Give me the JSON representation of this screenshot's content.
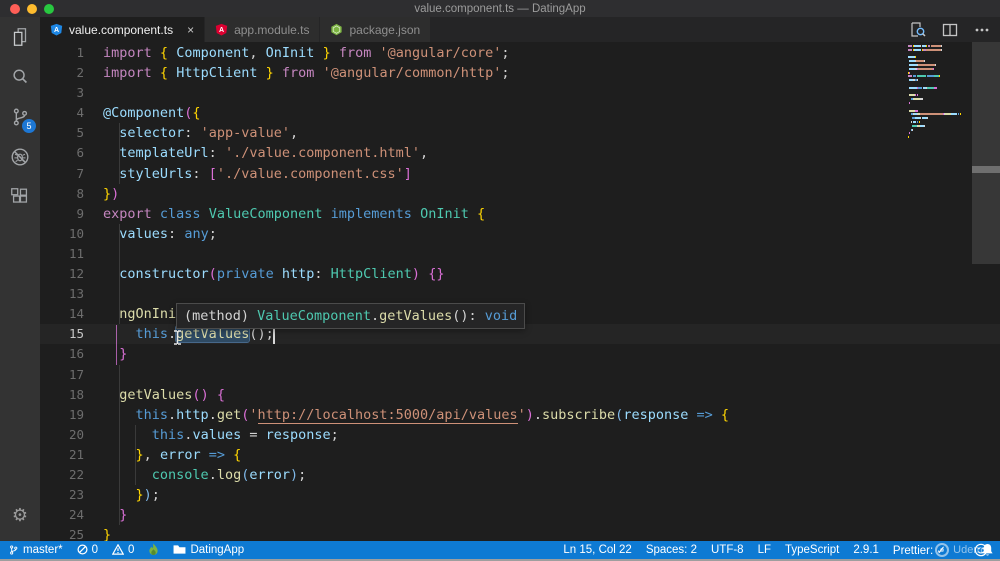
{
  "window": {
    "title": "value.component.ts — DatingApp"
  },
  "activity_bar": {
    "items": [
      {
        "name": "explorer",
        "icon": "files-icon"
      },
      {
        "name": "search",
        "icon": "search-icon"
      },
      {
        "name": "source-control",
        "icon": "git-branch-icon",
        "badge": "5"
      },
      {
        "name": "debug",
        "icon": "debug-icon"
      },
      {
        "name": "extensions",
        "icon": "extensions-icon"
      }
    ],
    "badge": "5",
    "bottom": [
      {
        "name": "settings",
        "icon": "gear-icon"
      }
    ]
  },
  "tabs": [
    {
      "label": "value.component.ts",
      "icon": "angular-component-icon",
      "icon_color": "#1e88e5",
      "active": true,
      "close_label": "×"
    },
    {
      "label": "app.module.ts",
      "icon": "angular-module-icon",
      "icon_color": "#dd0031",
      "active": false
    },
    {
      "label": "package.json",
      "icon": "npm-package-icon",
      "icon_color": "#7cb342",
      "active": false
    }
  ],
  "editor_actions": [
    {
      "name": "open-changes",
      "icon": "file-search-icon"
    },
    {
      "name": "split-editor",
      "icon": "split-editor-icon"
    },
    {
      "name": "more-actions",
      "icon": "ellipsis-icon"
    }
  ],
  "editor": {
    "colors": {
      "kw": "#C586C0",
      "kb": "#569CD6",
      "ty": "#4EC9B0",
      "va": "#9CDCFE",
      "fn": "#DCDCAA",
      "st": "#CE9178",
      "df": "#D4D4D4",
      "b1": "#FFD602",
      "b2": "#DA70D6",
      "b3": "#7FB8E8"
    },
    "cursor": {
      "line": 15,
      "col": 22
    },
    "lines": [
      {
        "n": 1,
        "t": [
          [
            "import",
            "kw"
          ],
          [
            " ",
            "df"
          ],
          [
            "{",
            "b1"
          ],
          [
            " ",
            "df"
          ],
          [
            "Component",
            "va"
          ],
          [
            ",",
            "df"
          ],
          [
            " ",
            "df"
          ],
          [
            "OnInit",
            "va"
          ],
          [
            " ",
            "df"
          ],
          [
            "}",
            "b1"
          ],
          [
            " ",
            "df"
          ],
          [
            "from",
            "kw"
          ],
          [
            " ",
            "df"
          ],
          [
            "'@angular/core'",
            "st"
          ],
          [
            ";",
            "df"
          ]
        ]
      },
      {
        "n": 2,
        "t": [
          [
            "import",
            "kw"
          ],
          [
            " ",
            "df"
          ],
          [
            "{",
            "b1"
          ],
          [
            " ",
            "df"
          ],
          [
            "HttpClient",
            "va"
          ],
          [
            " ",
            "df"
          ],
          [
            "}",
            "b1"
          ],
          [
            " ",
            "df"
          ],
          [
            "from",
            "kw"
          ],
          [
            " ",
            "df"
          ],
          [
            "'@angular/common/http'",
            "st"
          ],
          [
            ";",
            "df"
          ]
        ]
      },
      {
        "n": 3,
        "t": []
      },
      {
        "n": 4,
        "t": [
          [
            "@Component",
            "va"
          ],
          [
            "(",
            "b2"
          ],
          [
            "{",
            "b1"
          ]
        ]
      },
      {
        "n": 5,
        "t": [
          [
            "  ",
            "df"
          ],
          [
            "selector",
            "va"
          ],
          [
            ": ",
            "df"
          ],
          [
            "'app-value'",
            "st"
          ],
          [
            ",",
            "df"
          ]
        ]
      },
      {
        "n": 6,
        "t": [
          [
            "  ",
            "df"
          ],
          [
            "templateUrl",
            "va"
          ],
          [
            ": ",
            "df"
          ],
          [
            "'./value.component.html'",
            "st"
          ],
          [
            ",",
            "df"
          ]
        ]
      },
      {
        "n": 7,
        "t": [
          [
            "  ",
            "df"
          ],
          [
            "styleUrls",
            "va"
          ],
          [
            ": ",
            "df"
          ],
          [
            "[",
            "b2"
          ],
          [
            "'./value.component.css'",
            "st"
          ],
          [
            "]",
            "b2"
          ]
        ]
      },
      {
        "n": 8,
        "t": [
          [
            "}",
            "b1"
          ],
          [
            ")",
            "b2"
          ]
        ]
      },
      {
        "n": 9,
        "t": [
          [
            "export",
            "kw"
          ],
          [
            " ",
            "df"
          ],
          [
            "class",
            "kb"
          ],
          [
            " ",
            "df"
          ],
          [
            "ValueComponent",
            "ty"
          ],
          [
            " ",
            "df"
          ],
          [
            "implements",
            "kb"
          ],
          [
            " ",
            "df"
          ],
          [
            "OnInit",
            "ty"
          ],
          [
            " ",
            "df"
          ],
          [
            "{",
            "b1"
          ]
        ]
      },
      {
        "n": 10,
        "t": [
          [
            "  ",
            "df"
          ],
          [
            "values",
            "va"
          ],
          [
            ": ",
            "df"
          ],
          [
            "any",
            "kb"
          ],
          [
            ";",
            "df"
          ]
        ]
      },
      {
        "n": 11,
        "t": []
      },
      {
        "n": 12,
        "t": [
          [
            "  ",
            "df"
          ],
          [
            "constructor",
            "va"
          ],
          [
            "(",
            "b2"
          ],
          [
            "private",
            "kb"
          ],
          [
            " ",
            "df"
          ],
          [
            "http",
            "va"
          ],
          [
            ": ",
            "df"
          ],
          [
            "HttpClient",
            "ty"
          ],
          [
            ")",
            "b2"
          ],
          [
            " ",
            "df"
          ],
          [
            "{}",
            "b2"
          ]
        ]
      },
      {
        "n": 13,
        "t": []
      },
      {
        "n": 14,
        "t": [
          [
            "  ",
            "df"
          ],
          [
            "ngOnInit",
            "fn"
          ],
          [
            "(",
            "b2"
          ],
          [
            ")",
            "b2"
          ],
          [
            " ",
            "df"
          ],
          [
            "{",
            "b2"
          ]
        ]
      },
      {
        "n": 15,
        "t": [
          [
            "    ",
            "df"
          ],
          [
            "this",
            "kb"
          ],
          [
            ".",
            "df"
          ],
          [
            "getValues",
            "fn",
            "hl"
          ],
          [
            "(",
            "df"
          ],
          [
            ")",
            "df"
          ],
          [
            ";",
            "df"
          ]
        ]
      },
      {
        "n": 16,
        "t": [
          [
            "  ",
            "df"
          ],
          [
            "}",
            "b2"
          ]
        ]
      },
      {
        "n": 17,
        "t": []
      },
      {
        "n": 18,
        "t": [
          [
            "  ",
            "df"
          ],
          [
            "getValues",
            "fn"
          ],
          [
            "(",
            "b2"
          ],
          [
            ")",
            "b2"
          ],
          [
            " ",
            "df"
          ],
          [
            "{",
            "b2"
          ]
        ]
      },
      {
        "n": 19,
        "t": [
          [
            "    ",
            "df"
          ],
          [
            "this",
            "kb"
          ],
          [
            ".",
            "df"
          ],
          [
            "http",
            "va"
          ],
          [
            ".",
            "df"
          ],
          [
            "get",
            "fn"
          ],
          [
            "(",
            "b2"
          ],
          [
            "'",
            "st"
          ],
          [
            "http://localhost:5000/api/values",
            "st",
            "u"
          ],
          [
            "'",
            "st"
          ],
          [
            ")",
            "b2"
          ],
          [
            ".",
            "df"
          ],
          [
            "subscribe",
            "fn"
          ],
          [
            "(",
            "b3"
          ],
          [
            "response",
            "va"
          ],
          [
            " ",
            "df"
          ],
          [
            "=>",
            "kb"
          ],
          [
            " ",
            "df"
          ],
          [
            "{",
            "b1"
          ]
        ]
      },
      {
        "n": 20,
        "t": [
          [
            "      ",
            "df"
          ],
          [
            "this",
            "kb"
          ],
          [
            ".",
            "df"
          ],
          [
            "values",
            "va"
          ],
          [
            " ",
            "df"
          ],
          [
            "=",
            "df"
          ],
          [
            " ",
            "df"
          ],
          [
            "response",
            "va"
          ],
          [
            ";",
            "df"
          ]
        ]
      },
      {
        "n": 21,
        "t": [
          [
            "    ",
            "df"
          ],
          [
            "}",
            "b1"
          ],
          [
            ",",
            "df"
          ],
          [
            " ",
            "df"
          ],
          [
            "error",
            "va"
          ],
          [
            " ",
            "df"
          ],
          [
            "=>",
            "kb"
          ],
          [
            " ",
            "df"
          ],
          [
            "{",
            "b1"
          ]
        ]
      },
      {
        "n": 22,
        "t": [
          [
            "      ",
            "df"
          ],
          [
            "console",
            "ty"
          ],
          [
            ".",
            "df"
          ],
          [
            "log",
            "fn"
          ],
          [
            "(",
            "b3"
          ],
          [
            "error",
            "va"
          ],
          [
            ")",
            "b3"
          ],
          [
            ";",
            "df"
          ]
        ]
      },
      {
        "n": 23,
        "t": [
          [
            "    ",
            "df"
          ],
          [
            "}",
            "b1"
          ],
          [
            ")",
            "b3"
          ],
          [
            ";",
            "df"
          ]
        ]
      },
      {
        "n": 24,
        "t": [
          [
            "  ",
            "df"
          ],
          [
            "}",
            "b2"
          ]
        ]
      },
      {
        "n": 25,
        "t": [
          [
            "}",
            "b1"
          ]
        ]
      }
    ],
    "hover_tooltip": {
      "tokens": [
        [
          "(method) ",
          "df"
        ],
        [
          "ValueComponent",
          "ty"
        ],
        [
          ".",
          "df"
        ],
        [
          "getValues",
          "fn"
        ],
        [
          "(): ",
          "df"
        ],
        [
          "void",
          "kb"
        ]
      ]
    }
  },
  "status_bar": {
    "left": [
      {
        "name": "git-branch",
        "icon": "git-branch-icon",
        "label": "master*"
      },
      {
        "name": "errors",
        "icon": "error-icon",
        "label": "0"
      },
      {
        "name": "warnings",
        "icon": "warning-icon",
        "label": "0"
      },
      {
        "name": "flame",
        "icon": "flame-icon",
        "label": ""
      },
      {
        "name": "folder",
        "icon": "folder-icon",
        "label": "DatingApp"
      }
    ],
    "right": [
      {
        "name": "cursor-position",
        "label": "Ln 15, Col 22"
      },
      {
        "name": "indentation",
        "label": "Spaces: 2"
      },
      {
        "name": "encoding",
        "label": "UTF-8"
      },
      {
        "name": "eol",
        "label": "LF"
      },
      {
        "name": "language-mode",
        "label": "TypeScript"
      },
      {
        "name": "ts-version",
        "label": "2.9.1"
      },
      {
        "name": "prettier",
        "label": "Prettier: ✓"
      }
    ],
    "right_icons": [
      {
        "name": "feedback",
        "icon": "smiley-icon"
      },
      {
        "name": "notifications",
        "icon": "bell-icon"
      }
    ]
  },
  "watermark": {
    "label": "Udemy"
  }
}
